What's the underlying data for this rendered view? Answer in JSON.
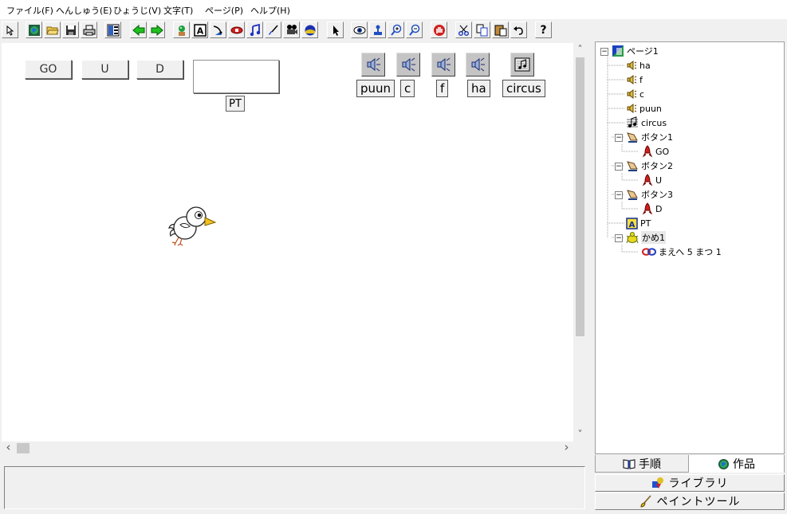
{
  "menubar": {
    "items": [
      {
        "label": "ファイル(F)",
        "icon": "menu-file"
      },
      {
        "label": "へんしゅう(E)",
        "icon": "menu-edit"
      },
      {
        "label": "ひょうじ(V)",
        "icon": "menu-view"
      },
      {
        "label": "文字(T)",
        "icon": "menu-text"
      },
      {
        "label": "ページ(P)",
        "icon": "menu-page"
      },
      {
        "label": "ヘルプ(H)",
        "icon": "menu-help"
      }
    ]
  },
  "toolbar": {
    "icons": [
      "pointer-select-icon",
      "globe-icon",
      "open-folder-icon",
      "save-disk-icon",
      "print-icon",
      "layout-icon",
      "back-arrow-icon",
      "forward-arrow-icon",
      "character-add-icon",
      "text-box-icon",
      "antenna-icon",
      "capsule-icon",
      "music-note-icon",
      "brush-icon",
      "projector-icon",
      "sphere-icon",
      "cursor-arrow-icon",
      "eye-icon",
      "stamp-icon",
      "zoom-in-icon",
      "zoom-out-icon",
      "stop-hand-icon",
      "cut-icon",
      "copy-icon",
      "paste-icon",
      "undo-icon",
      "help-question-icon"
    ],
    "help_glyph": "?"
  },
  "stage": {
    "buttons": [
      {
        "label": "GO"
      },
      {
        "label": "U"
      },
      {
        "label": "D"
      }
    ],
    "textbox_value": "",
    "pt_label": "PT",
    "sound_buttons": [
      {
        "label": "puun",
        "icon": "speaker-icon"
      },
      {
        "label": "c",
        "icon": "speaker-icon"
      },
      {
        "label": "f",
        "icon": "speaker-icon"
      },
      {
        "label": "ha",
        "icon": "speaker-icon"
      },
      {
        "label": "circus",
        "icon": "music-score-icon"
      }
    ],
    "character": "bird-character"
  },
  "scrollbars": {
    "up": "˄",
    "down": "˅",
    "left": "‹",
    "right": "›"
  },
  "tree": {
    "items": [
      {
        "label": "ページ1",
        "icon": "page-icon",
        "expander": "−"
      },
      {
        "label": "ha",
        "icon": "speaker-icon"
      },
      {
        "label": "f",
        "icon": "speaker-icon"
      },
      {
        "label": "c",
        "icon": "speaker-icon"
      },
      {
        "label": "puun",
        "icon": "speaker-icon"
      },
      {
        "label": "circus",
        "icon": "music-score-icon"
      },
      {
        "label": "ボタン1",
        "icon": "button-object-icon",
        "expander": "−"
      },
      {
        "label": "GO",
        "icon": "rocket-icon"
      },
      {
        "label": "ボタン2",
        "icon": "button-object-icon",
        "expander": "−"
      },
      {
        "label": "U",
        "icon": "rocket-icon"
      },
      {
        "label": "ボタン3",
        "icon": "button-object-icon",
        "expander": "−"
      },
      {
        "label": "D",
        "icon": "rocket-icon"
      },
      {
        "label": "PT",
        "icon": "text-a-icon"
      },
      {
        "label": "かめ1",
        "icon": "turtle-icon",
        "expander": "−"
      },
      {
        "label": "まえへ 5 まつ 1",
        "icon": "loop-icon"
      }
    ]
  },
  "tabs": {
    "procedure": "手順",
    "works": "作品",
    "library": "ライブラリ",
    "paint_tool": "ペイントツール"
  }
}
